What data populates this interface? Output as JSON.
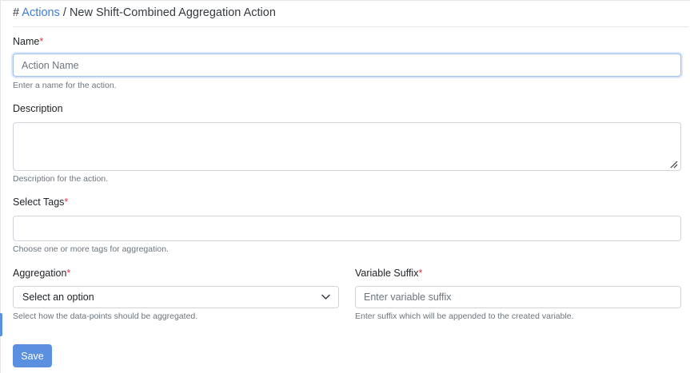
{
  "breadcrumb": {
    "hash": "# ",
    "parent": "Actions",
    "separator": " / ",
    "current": "New Shift-Combined Aggregation Action"
  },
  "form": {
    "name": {
      "label": "Name",
      "required_mark": "*",
      "placeholder": "Action Name",
      "value": "",
      "help": "Enter a name for the action."
    },
    "description": {
      "label": "Description",
      "value": "",
      "help": "Description for the action."
    },
    "tags": {
      "label": "Select Tags",
      "required_mark": "*",
      "value": "",
      "help": "Choose one or more tags for aggregation."
    },
    "aggregation": {
      "label": "Aggregation",
      "required_mark": "*",
      "selected": "Select an option",
      "help": "Select how the data-points should be aggregated."
    },
    "variable_suffix": {
      "label": "Variable Suffix",
      "required_mark": "*",
      "placeholder": "Enter variable suffix",
      "value": "",
      "help": "Enter suffix which will be appended to the created variable."
    },
    "save_label": "Save"
  },
  "icons": {
    "aggregation_dropdown": "chevron-down-icon",
    "description_resize": "resize-grip-icon"
  },
  "colors": {
    "accent": "#5b8fe0",
    "link": "#3d7bd9",
    "required": "#dc3545",
    "focus_border": "#9fc0ee"
  }
}
